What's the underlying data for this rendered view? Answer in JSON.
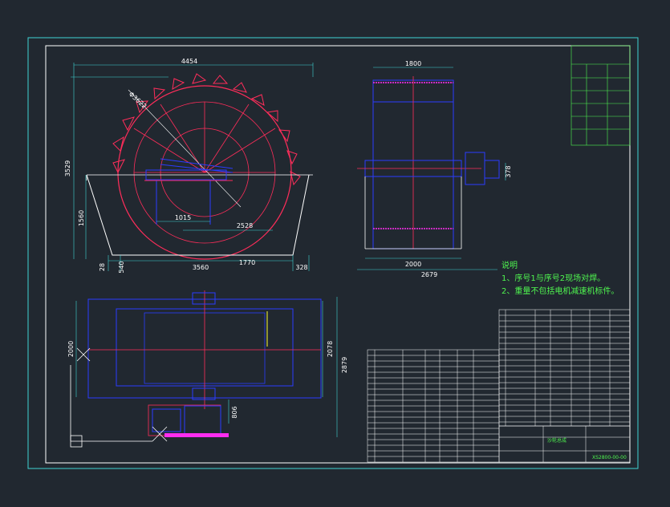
{
  "colors": {
    "background": "#212830",
    "border": "#3fd4d4",
    "frame": "#ffffff",
    "wheel": "#ff2d5a",
    "structure": "#2b3cff",
    "dimension": "#3fd4d4",
    "note": "#4ff54f",
    "table_line": "#ffffff",
    "table_accent": "#4ff54f",
    "highlight": "#ffff33",
    "magenta": "#ff2df0"
  },
  "front_view": {
    "dim_top": "4454",
    "dim_diameter": "Φ3622",
    "dim_left_height": "3529",
    "dim_water_height": "1560",
    "dim_center": "1015",
    "dim_radius": "2528",
    "dim_base_left": "28",
    "dim_base_small": "540",
    "dim_base_width": "3560",
    "dim_base_inner": "1770",
    "dim_base_right": "328"
  },
  "side_view": {
    "dim_top": "1800",
    "dim_bottom_inner": "2000",
    "dim_bottom_outer": "2679",
    "dim_side": "378"
  },
  "plan_view": {
    "dim_left": "2000",
    "dim_right_inner": "2078",
    "dim_right_outer": "2879",
    "dim_bottom": "806"
  },
  "notes": {
    "title": "说明",
    "line1": "1、序号1与序号2现场对焊。",
    "line2": "2、重量不包括电机减速机标件。"
  },
  "title_block": {
    "name": "沙轮总成",
    "code": "XS2800-00-00"
  }
}
